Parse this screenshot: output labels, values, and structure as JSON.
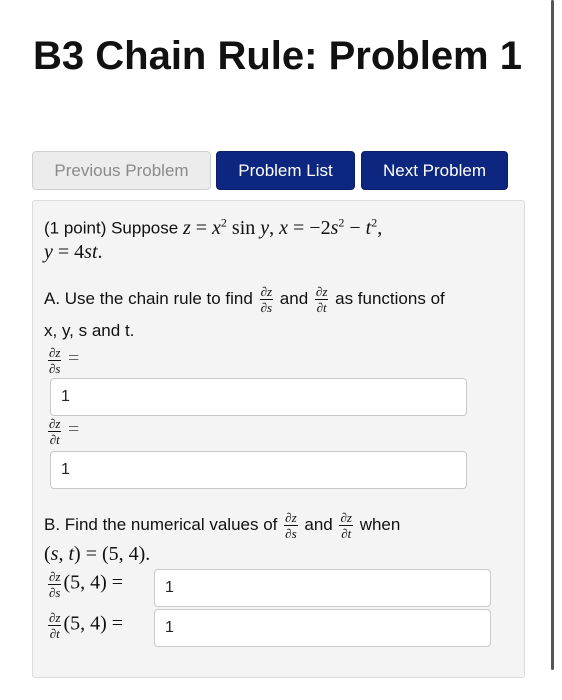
{
  "page": {
    "title": "B3 Chain Rule: Problem 1"
  },
  "nav": {
    "previous_label": "Previous Problem",
    "list_label": "Problem List",
    "next_label": "Next Problem"
  },
  "problem": {
    "points": "(1 point) Suppose",
    "part_a_text": "A. Use the chain rule to find",
    "part_a_and": "and",
    "part_a_suffix": "as functions of",
    "part_a_line2": "x, y, s and t.",
    "part_b_text": "B. Find the numerical values of",
    "part_b_and": "and",
    "part_b_when": "when",
    "answers": {
      "dz_ds": "1",
      "dz_dt": "1",
      "dz_ds_at": "1",
      "dz_dt_at": "1"
    }
  },
  "colors": {
    "primary_button": "#0d2781",
    "disabled_button": "#ececec",
    "card_bg": "#f4f4f4"
  }
}
